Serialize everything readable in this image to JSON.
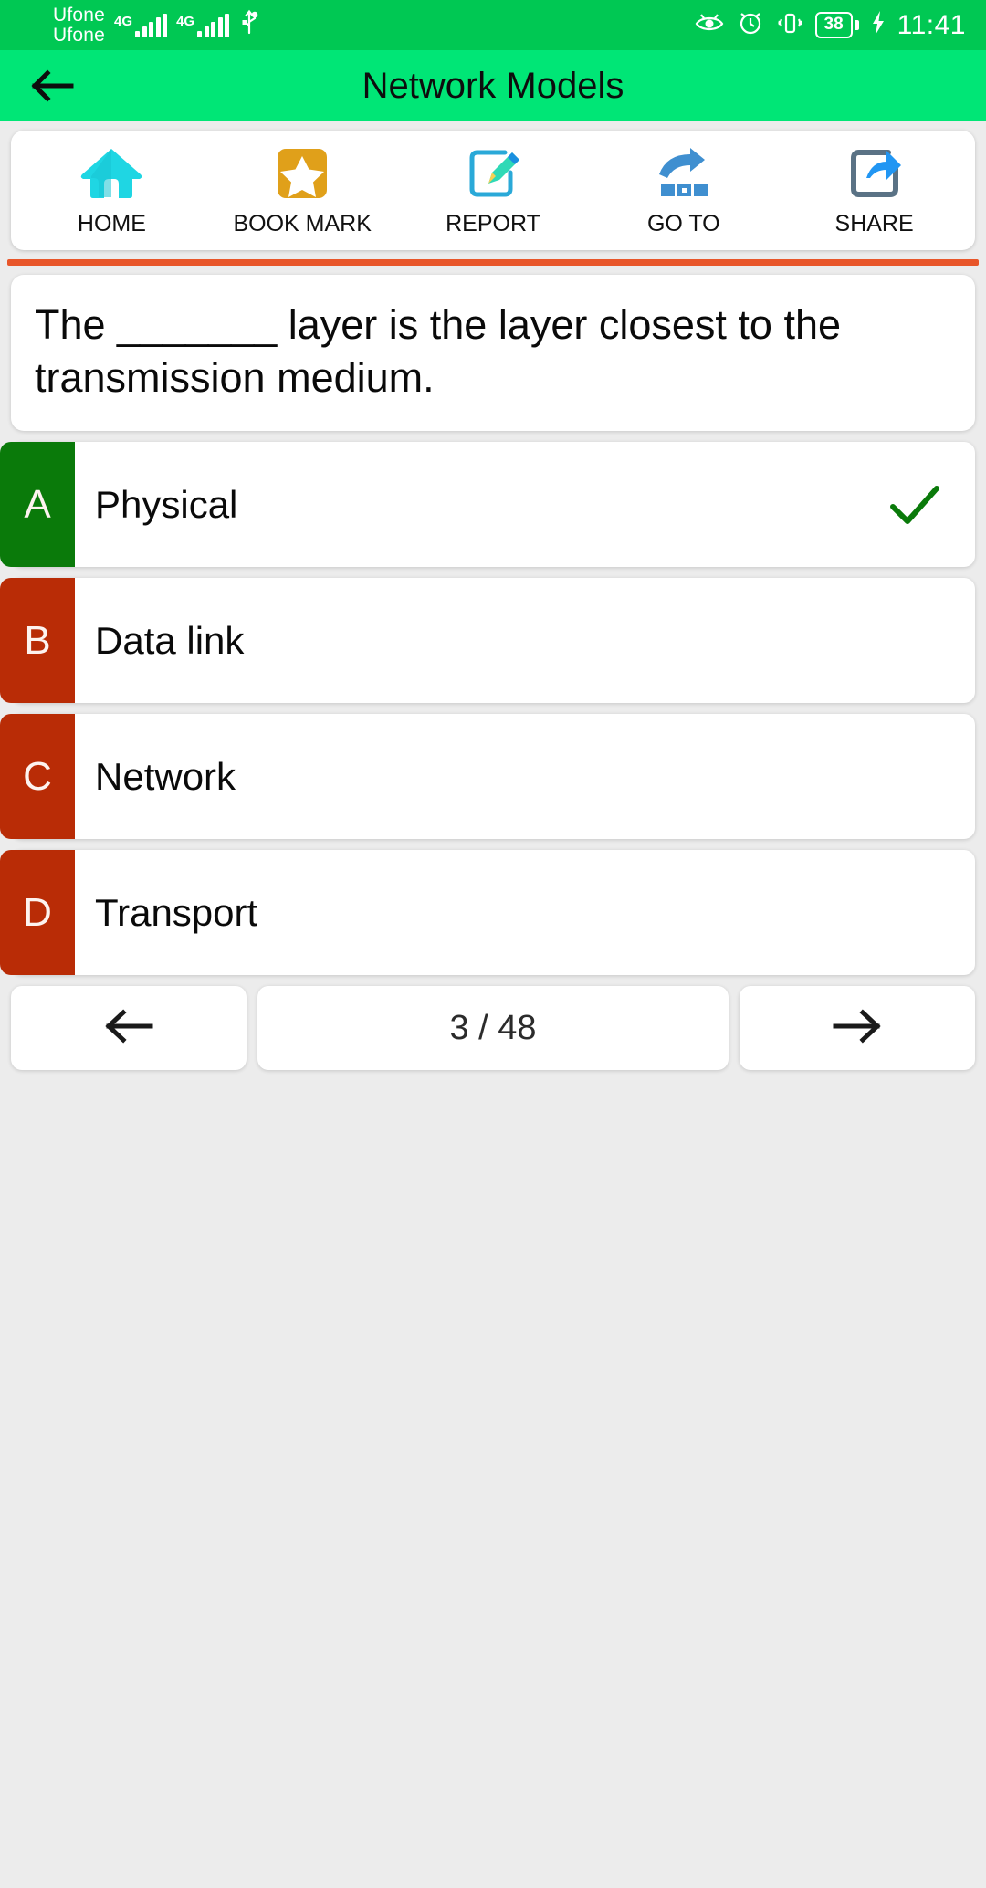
{
  "status_bar": {
    "sim1_carrier": "Ufone",
    "sim2_carrier": "Ufone",
    "sim1_network": "4G",
    "sim2_network": "4G",
    "usb_icon": "usb-icon",
    "eye_icon": "eye-care-icon",
    "alarm_icon": "alarm-clock-icon",
    "vibrate_icon": "vibrate-icon",
    "battery_level": "38",
    "charging_icon": "charging-bolt-icon",
    "time": "11:41",
    "background_color": "#00c853"
  },
  "app_bar": {
    "back_icon": "back-arrow-icon",
    "title": "Network Models",
    "background_color": "#00e676"
  },
  "toolbar": {
    "items": [
      {
        "label": "HOME",
        "icon": "home-icon",
        "color": "#22d3e0"
      },
      {
        "label": "BOOK MARK",
        "icon": "bookmark-star-icon",
        "color": "#e0a01a"
      },
      {
        "label": "REPORT",
        "icon": "report-edit-icon",
        "color": "#2aa9d8"
      },
      {
        "label": "GO TO",
        "icon": "go-to-icon",
        "color": "#3f8fd0"
      },
      {
        "label": "SHARE",
        "icon": "share-icon",
        "color": "#2196f3"
      }
    ]
  },
  "divider_color": "#e8562a",
  "question": {
    "text": "The _______ layer is the layer closest to the transmission medium."
  },
  "options": [
    {
      "key": "A",
      "label": "Physical",
      "badge_color": "#0a7a0a",
      "correct": true,
      "check_icon": "check-mark-icon"
    },
    {
      "key": "B",
      "label": "Data link",
      "badge_color": "#b92c06",
      "correct": false,
      "check_icon": ""
    },
    {
      "key": "C",
      "label": "Network",
      "badge_color": "#b92c06",
      "correct": false,
      "check_icon": ""
    },
    {
      "key": "D",
      "label": "Transport",
      "badge_color": "#b92c06",
      "correct": false,
      "check_icon": ""
    }
  ],
  "footer": {
    "prev_icon": "arrow-left-icon",
    "next_icon": "arrow-right-icon",
    "counter": "3 / 48",
    "current_index": 3,
    "total": 48
  }
}
